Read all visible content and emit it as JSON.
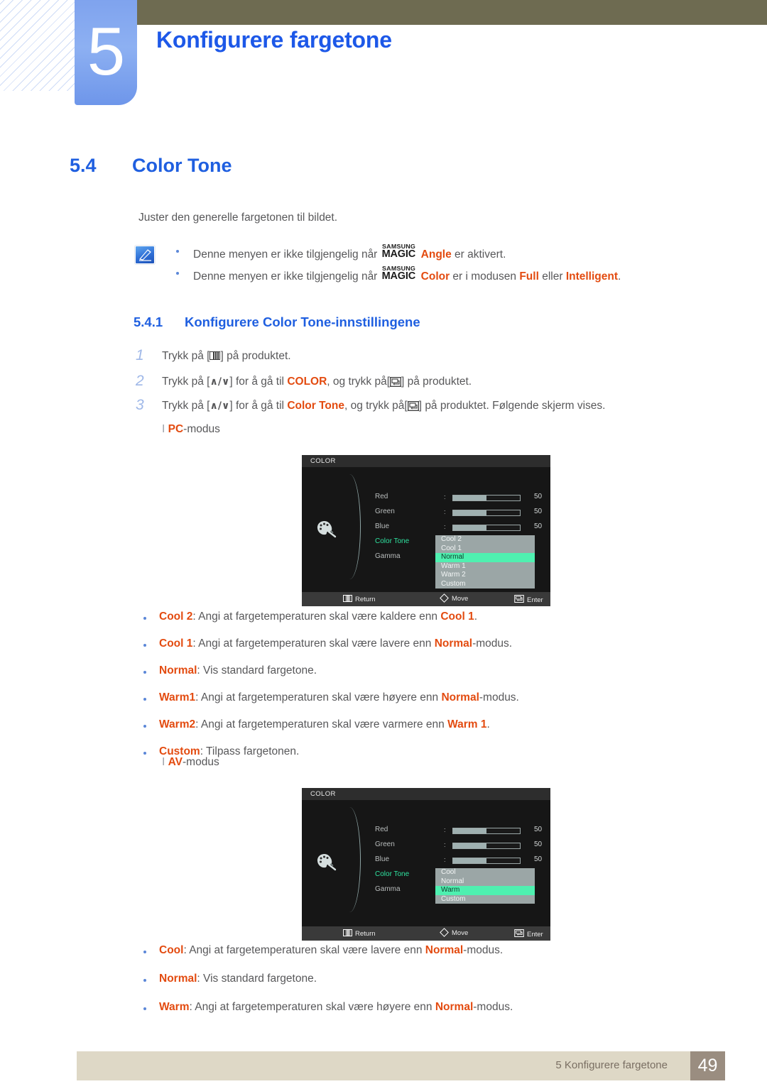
{
  "chapter": {
    "number": "5",
    "title": "Konfigurere fargetone"
  },
  "section": {
    "number": "5.4",
    "title": "Color Tone",
    "intro": "Juster den generelle fargetonen til bildet."
  },
  "notes": [
    {
      "pre": "Denne menyen er ikke tilgjengelig når ",
      "logo_top": "SAMSUNG",
      "logo_bottom": "MAGIC",
      "highlight": "Angle",
      "post": " er aktivert."
    },
    {
      "pre": "Denne menyen er ikke tilgjengelig når ",
      "logo_top": "SAMSUNG",
      "logo_bottom": "MAGIC",
      "highlight": "Color",
      "mid": " er i modusen ",
      "opt1": "Full",
      "conj": " eller ",
      "opt2": "Intelligent",
      "post": "."
    }
  ],
  "subsection": {
    "number": "5.4.1",
    "title": "Konfigurere Color Tone-innstillingene"
  },
  "steps": [
    {
      "num": "1",
      "a": "Trykk på [",
      "b": "] på produktet.",
      "icon": "menu-button-icon"
    },
    {
      "num": "2",
      "a": "Trykk på [",
      "arrows": "∧/∨",
      "b": "] for å gå til ",
      "target": "COLOR",
      "c": ", og trykk på[",
      "d": "] på produktet.",
      "icon": "enter-button-icon"
    },
    {
      "num": "3",
      "a": "Trykk på [",
      "arrows": "∧/∨",
      "b": "] for å gå til ",
      "target": "Color Tone",
      "c": ", og trykk på[",
      "d": "] på produktet. Følgende skjerm vises.",
      "icon": "enter-button-icon"
    }
  ],
  "mode_pc": {
    "bar": "I",
    "label": "PC",
    "suffix": "-modus"
  },
  "mode_av": {
    "bar": "I",
    "label": "AV",
    "suffix": "-modus"
  },
  "osd_pc": {
    "title": "COLOR",
    "rows": [
      {
        "label": "Red",
        "colon": ":",
        "value": "50",
        "fill_pct": 50
      },
      {
        "label": "Green",
        "colon": ":",
        "value": "50",
        "fill_pct": 50
      },
      {
        "label": "Blue",
        "colon": ":",
        "value": "50",
        "fill_pct": 50
      },
      {
        "label": "Color Tone",
        "colon": ":",
        "value": "",
        "fill_pct": 0
      },
      {
        "label": "Gamma",
        "colon": ":",
        "value": "",
        "fill_pct": 0
      }
    ],
    "dropdown": {
      "options": [
        "Cool 2",
        "Cool 1",
        "Normal",
        "Warm 1",
        "Warm 2",
        "Custom"
      ],
      "selected": "Normal"
    },
    "footer": {
      "return": "Return",
      "move": "Move",
      "enter": "Enter"
    }
  },
  "osd_av": {
    "title": "COLOR",
    "rows": [
      {
        "label": "Red",
        "colon": ":",
        "value": "50",
        "fill_pct": 50
      },
      {
        "label": "Green",
        "colon": ":",
        "value": "50",
        "fill_pct": 50
      },
      {
        "label": "Blue",
        "colon": ":",
        "value": "50",
        "fill_pct": 50
      },
      {
        "label": "Color Tone",
        "colon": ":",
        "value": "",
        "fill_pct": 0
      },
      {
        "label": "Gamma",
        "colon": ":",
        "value": "",
        "fill_pct": 0
      }
    ],
    "dropdown": {
      "options": [
        "Cool",
        "Normal",
        "Warm",
        "Custom"
      ],
      "selected": "Warm"
    },
    "footer": {
      "return": "Return",
      "move": "Move",
      "enter": "Enter"
    }
  },
  "bullets_pc": [
    {
      "term": "Cool 2",
      "rest": ": Angi at fargetemperaturen skal være kaldere enn ",
      "term2": "Cool 1",
      "tail": "."
    },
    {
      "term": "Cool 1",
      "rest": ": Angi at fargetemperaturen skal være lavere enn ",
      "term2": "Normal",
      "tail": "-modus."
    },
    {
      "term": "Normal",
      "rest": ": Vis standard fargetone.",
      "term2": "",
      "tail": ""
    },
    {
      "term": "Warm1",
      "rest": ": Angi at fargetemperaturen skal være høyere enn ",
      "term2": "Normal",
      "tail": "-modus."
    },
    {
      "term": "Warm2",
      "rest": ": Angi at fargetemperaturen skal være varmere enn ",
      "term2": "Warm 1",
      "tail": "."
    },
    {
      "term": "Custom",
      "rest": ": Tilpass fargetonen.",
      "term2": "",
      "tail": ""
    }
  ],
  "bullets_av": [
    {
      "term": "Cool",
      "rest": ": Angi at fargetemperaturen skal være lavere enn ",
      "term2": "Normal",
      "tail": "-modus."
    },
    {
      "term": "Normal",
      "rest": ": Vis standard fargetone.",
      "term2": "",
      "tail": ""
    },
    {
      "term": "Warm",
      "rest": ": Angi at fargetemperaturen skal være høyere enn ",
      "term2": "Normal",
      "tail": "-modus."
    }
  ],
  "footer": {
    "text": "5 Konfigurere fargetone",
    "page": "49"
  },
  "colors": {
    "accent_blue": "#1f5fe0",
    "chapter_blue": "#1d58e8",
    "orange": "#e34b10",
    "olive": "#6e6b51",
    "footer_band": "#ded8c6",
    "footer_page": "#9a8d80",
    "osd_highlight": "#4ff0b0"
  }
}
